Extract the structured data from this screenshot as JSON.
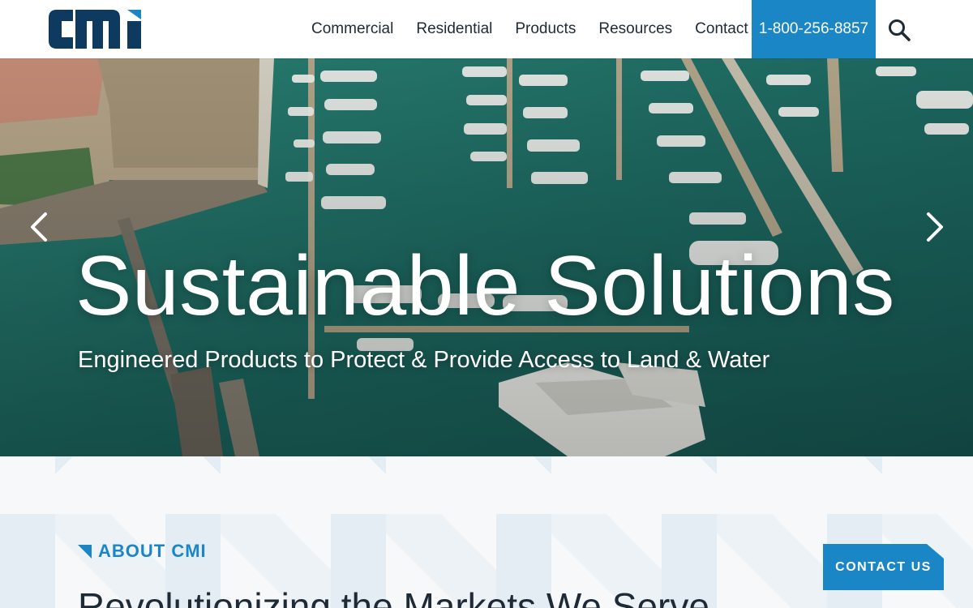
{
  "brand": {
    "logo_text": "cmi",
    "accent_color": "#1b86c6",
    "navy_color": "#0f3a5f"
  },
  "nav": {
    "items": [
      {
        "label": "Commercial"
      },
      {
        "label": "Residential"
      },
      {
        "label": "Products"
      },
      {
        "label": "Resources"
      },
      {
        "label": "Contact"
      }
    ],
    "phone": "1-800-256-8857",
    "search_icon": "search-icon"
  },
  "hero": {
    "title": "Sustainable Solutions",
    "subtitle": "Engineered Products to Protect & Provide Access to Land & Water",
    "prev_icon": "chevron-left-icon",
    "next_icon": "chevron-right-icon"
  },
  "about": {
    "eyebrow": "ABOUT CMI",
    "heading": "Revolutionizing the Markets We Serve"
  },
  "floating": {
    "contact_label": "CONTACT US"
  }
}
